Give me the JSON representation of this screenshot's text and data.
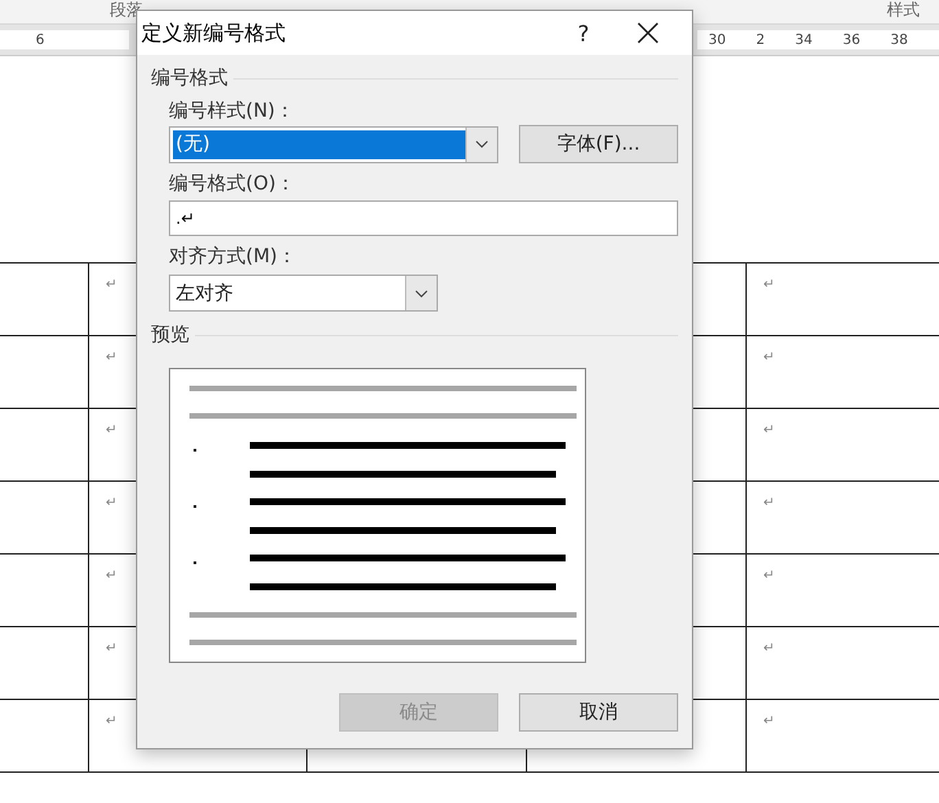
{
  "ribbon": {
    "groups": [
      "段落",
      "样式"
    ]
  },
  "ruler": {
    "left_numbers": [
      "6"
    ],
    "right_numbers": [
      "30",
      "2",
      "34",
      "36",
      "38"
    ]
  },
  "document_table": {
    "rows": [
      {
        "cells": [
          "↵",
          "↵"
        ]
      },
      {
        "cells": [
          "↵",
          "↵"
        ]
      },
      {
        "cells": [
          "↵",
          "↵"
        ]
      },
      {
        "cells": [
          "↵",
          "↵"
        ]
      },
      {
        "cells": [
          "↵",
          "↵"
        ]
      },
      {
        "cells": [
          "↵",
          "↵"
        ]
      },
      {
        "cells": [
          "↵",
          "↵"
        ]
      }
    ]
  },
  "dialog": {
    "title": "定义新编号格式",
    "help": "?",
    "number_format_group": "编号格式",
    "style_label": "编号样式(N)：",
    "style_value": "(无)",
    "font_button": "字体(F)...",
    "format_label": "编号格式(O)：",
    "format_value": ".↵",
    "align_label": "对齐方式(M)：",
    "align_value": "左对齐",
    "preview_group": "预览",
    "buttons": [
      {
        "label": "确定",
        "disabled": true
      },
      {
        "label": "取消",
        "disabled": false
      }
    ]
  }
}
